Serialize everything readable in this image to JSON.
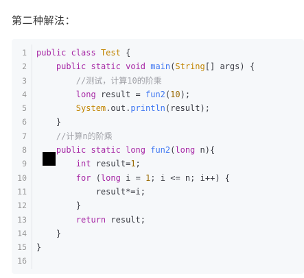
{
  "heading": "第二种解法：",
  "code": {
    "lines": [
      {
        "n": "1",
        "t": "public class Test {"
      },
      {
        "n": "2",
        "t": "    public static void main(String[] args) {"
      },
      {
        "n": "3",
        "t": "        //测试，计算10的阶乘"
      },
      {
        "n": "4",
        "t": "        long result = fun2(10);"
      },
      {
        "n": "5",
        "t": "        System.out.println(result);"
      },
      {
        "n": "6",
        "t": "    }"
      },
      {
        "n": "7",
        "t": "    //计算n的阶乘"
      },
      {
        "n": "8",
        "t": "    public static long fun2(long n){"
      },
      {
        "n": "9",
        "t": "        int result=1;"
      },
      {
        "n": "10",
        "t": "        for (long i = 1; i <= n; i++) {"
      },
      {
        "n": "11",
        "t": "            result*=i;"
      },
      {
        "n": "12",
        "t": "        }"
      },
      {
        "n": "13",
        "t": "        return result;"
      },
      {
        "n": "14",
        "t": "    }"
      },
      {
        "n": "15",
        "t": "}"
      },
      {
        "n": "16",
        "t": ""
      }
    ]
  },
  "colors": {
    "code_background": "#f6f8fa",
    "keyword": "#a626a4",
    "comment": "#a0a1a7",
    "number": "#986801"
  }
}
